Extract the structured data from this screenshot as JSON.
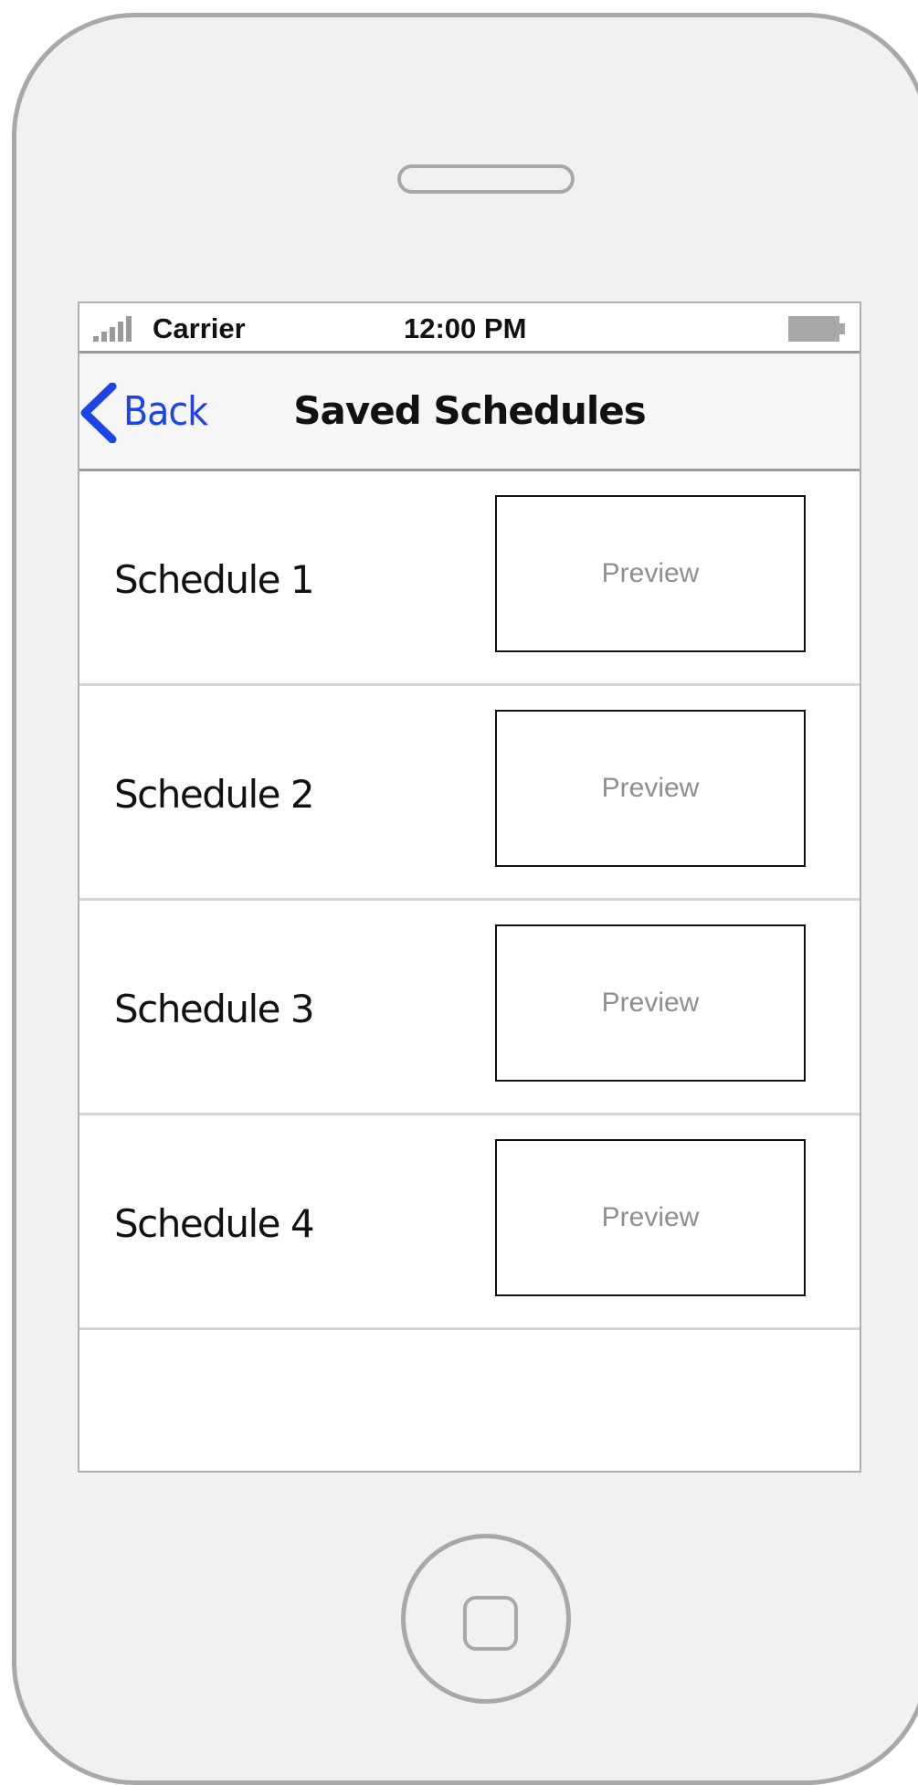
{
  "status_bar": {
    "carrier": "Carrier",
    "time": "12:00 PM"
  },
  "nav": {
    "back_label": "Back",
    "title": "Saved Schedules"
  },
  "schedules": [
    {
      "label": "Schedule 1",
      "preview_label": "Preview"
    },
    {
      "label": "Schedule 2",
      "preview_label": "Preview"
    },
    {
      "label": "Schedule 3",
      "preview_label": "Preview"
    },
    {
      "label": "Schedule 4",
      "preview_label": "Preview"
    }
  ],
  "colors": {
    "accent": "#1d44e8",
    "device_frame": "#a8a8a8",
    "preview_text": "#8f8f8f"
  }
}
